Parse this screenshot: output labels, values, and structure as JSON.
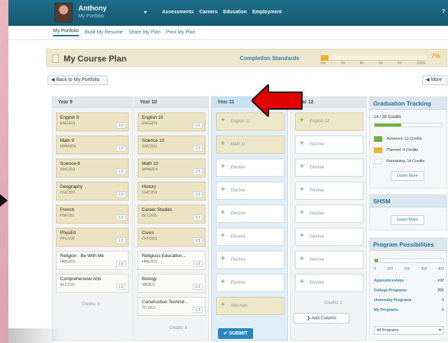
{
  "header": {
    "user_name": "Anthony",
    "user_link": "My Portfolio",
    "nav": [
      "Assessments",
      "Careers",
      "Education",
      "Employment"
    ],
    "menu_toggle_glyph": "▾",
    "right_glyph": "?"
  },
  "subnav": [
    "My Portfolio",
    "Build My Resume",
    "Share My Plan",
    "Print My Plan"
  ],
  "plan": {
    "title": "My Course Plan",
    "completion_label": "Completion Standards",
    "completion_percent": 0.07,
    "completion_percent_text": "7%",
    "progress_ticks": [
      "0%",
      "20",
      "40",
      "60",
      "80",
      "100%"
    ]
  },
  "buttons": {
    "back": "◀ Back to My Portfolio",
    "more": "◀ More",
    "submit": "✔ SUBMIT",
    "add_column": "❯ Add Column"
  },
  "columns": [
    {
      "title": "Year 9",
      "courses": [
        {
          "name": "English 9",
          "code": "ENG1D1",
          "credit": "1.0",
          "style": "tan"
        },
        {
          "name": "Math 9",
          "code": "MPM1D1",
          "credit": "1.0",
          "style": "tan"
        },
        {
          "name": "Science 9",
          "code": "SNC1D1",
          "credit": "1.0",
          "style": "tan"
        },
        {
          "name": "Geography",
          "code": "CGC1D1",
          "credit": "1.0",
          "style": "tan"
        },
        {
          "name": "French",
          "code": "FSF1D1",
          "credit": "1.0",
          "style": "tan"
        },
        {
          "name": "PhysEd",
          "code": "PPL1OF",
          "credit": "1.0",
          "style": "tan"
        },
        {
          "name": "Religion - Be With Me",
          "code": "HRE1O1",
          "credit": "1.0",
          "style": "white"
        },
        {
          "name": "Comprehensive Arts",
          "code": "ALC1O1",
          "credit": "1.0",
          "style": "white"
        }
      ],
      "credits": "Credits: 8"
    },
    {
      "title": "Year 10",
      "courses": [
        {
          "name": "English 10",
          "code": "ENG2D1",
          "credit": "1.0",
          "style": "tan"
        },
        {
          "name": "Science 10",
          "code": "SNC2D1",
          "credit": "1.0",
          "style": "tan"
        },
        {
          "name": "Math 10",
          "code": "MPM2D1",
          "credit": "1.0",
          "style": "tan"
        },
        {
          "name": "History",
          "code": "CHC2D1",
          "credit": "1.0",
          "style": "tan"
        },
        {
          "name": "Career Studies",
          "code": "GLC2O1",
          "credit": "0.5",
          "style": "tan"
        },
        {
          "name": "Civics",
          "code": "CHV2O1",
          "credit": "0.5",
          "style": "tan"
        },
        {
          "name": "Religious Education...",
          "code": "HRE2O1",
          "credit": "1.0",
          "style": "white"
        },
        {
          "name": "Biology",
          "code": "SBI3U1",
          "credit": "1.0",
          "style": "white"
        },
        {
          "name": "Construction Technol...",
          "code": "TCJ3C1",
          "credit": "1.0",
          "style": "white"
        }
      ],
      "credits": "Credits: 8"
    }
  ],
  "year11": {
    "title": "Year 11",
    "slots": [
      {
        "label": "English 11",
        "style": "tan"
      },
      {
        "label": "Math 11",
        "style": "tan"
      },
      {
        "label": "Elective",
        "style": "white"
      },
      {
        "label": "Elective",
        "style": "white"
      },
      {
        "label": "Elective",
        "style": "white"
      },
      {
        "label": "Elective",
        "style": "white"
      },
      {
        "label": "Elective",
        "style": "white"
      },
      {
        "label": "Elective",
        "style": "white"
      },
      {
        "label": "Alternate",
        "style": "tan"
      }
    ]
  },
  "year12": {
    "title": "Year 12",
    "slots": [
      {
        "label": "English 12",
        "style": "tan",
        "plus": "green"
      },
      {
        "label": "Elective",
        "style": "white"
      },
      {
        "label": "Elective",
        "style": "white"
      },
      {
        "label": "Elective",
        "style": "white"
      },
      {
        "label": "Elective",
        "style": "white"
      },
      {
        "label": "Elective",
        "style": "white"
      },
      {
        "label": "Elective",
        "style": "white"
      },
      {
        "label": "Elective",
        "style": "white"
      }
    ],
    "credits": "Credits: 1"
  },
  "graduation": {
    "title": "Graduation Tracking",
    "credits_text": "14 / 30 Credits",
    "credits_fraction": 0.4,
    "legend": [
      {
        "label": "Achieved: 12 Credits",
        "color": "#6cb038"
      },
      {
        "label": "Planned: 4 Credits",
        "color": "#e8b52b"
      },
      {
        "label": "Remaining: 14 Credits",
        "color": "#ffffff"
      }
    ],
    "learn_more": "Learn More"
  },
  "shsm": {
    "title": "SHSM",
    "learn_more": "Learn More"
  },
  "programs": {
    "title": "Program Possibilities",
    "fraction": 0.05,
    "ticks": [
      "0",
      "100",
      "200",
      "300",
      "400"
    ],
    "rows": [
      {
        "name": "Apprenticeships",
        "value": "102"
      },
      {
        "name": "College Programs",
        "value": "200"
      },
      {
        "name": "University Programs",
        "value": "3"
      },
      {
        "name": "My Programs",
        "value": "0"
      }
    ],
    "select_value": "All Programs"
  },
  "colors": {
    "accent": "#1e6f8c",
    "arrow": "#e00000",
    "gold": "#e8b52b",
    "green": "#6cb038"
  }
}
